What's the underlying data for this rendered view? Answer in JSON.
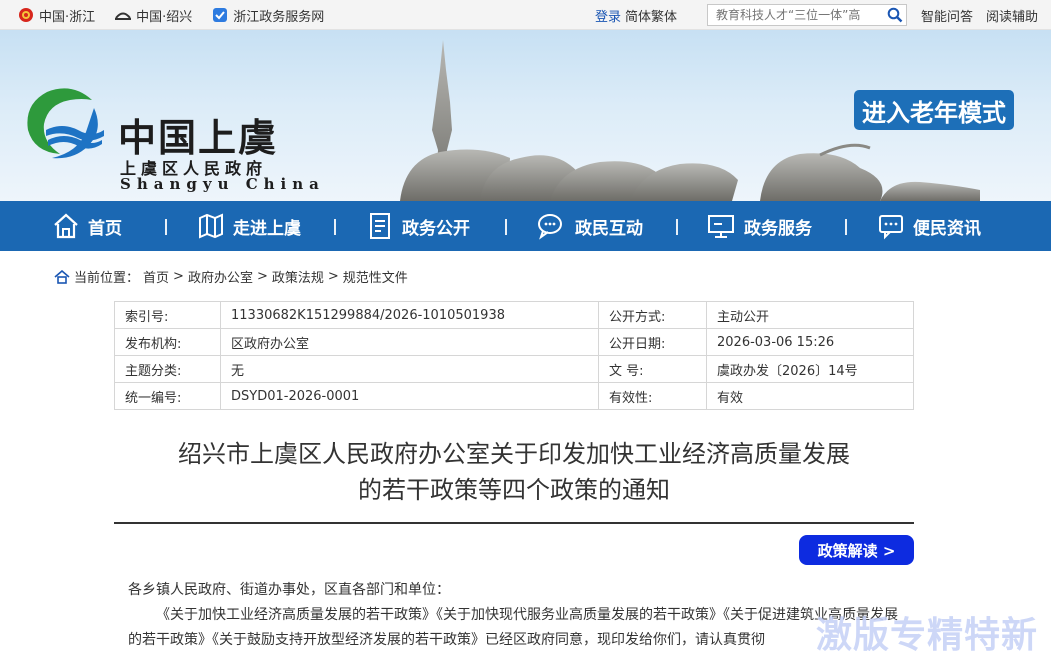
{
  "topbar": {
    "links": [
      {
        "label": "中国·浙江",
        "icon": "national-emblem-icon"
      },
      {
        "label": "中国·绍兴",
        "icon": "bridge-icon"
      },
      {
        "label": "浙江政务服务网",
        "icon": "gov-service-icon"
      }
    ],
    "login": "登录",
    "lang": "简体繁体",
    "search_placeholder": "教育科技人才“三位一体”高",
    "assistant": "智能问答",
    "accessibility": "阅读辅助"
  },
  "banner": {
    "site_name": "中国上虞",
    "site_sub": "上虞区人民政府",
    "site_en": "Shangyu China",
    "elder_mode": "进入老年模式"
  },
  "nav": [
    {
      "label": "首页",
      "icon": "home-icon"
    },
    {
      "label": "走进上虞",
      "icon": "map-icon"
    },
    {
      "label": "政务公开",
      "icon": "document-icon"
    },
    {
      "label": "政民互动",
      "icon": "chat-icon"
    },
    {
      "label": "政务服务",
      "icon": "monitor-icon"
    },
    {
      "label": "便民资讯",
      "icon": "message-icon"
    }
  ],
  "breadcrumb": {
    "prefix": "当前位置：",
    "items": [
      "首页",
      "政府办公室",
      "政策法规",
      "规范性文件"
    ]
  },
  "info": {
    "rows": [
      {
        "k1": "索引号:",
        "v1": "11330682K151299884/2026-1010501938",
        "k2": "公开方式:",
        "v2": "主动公开"
      },
      {
        "k1": "发布机构:",
        "v1": "区政府办公室",
        "k2": "公开日期:",
        "v2": "2026-03-06 15:26"
      },
      {
        "k1": "主题分类:",
        "v1": "无",
        "k2": "文  号:",
        "v2": "虞政办发〔2026〕14号"
      },
      {
        "k1": "统一编号:",
        "v1": "DSYD01-2026-0001",
        "k2": "有效性:",
        "v2": "有效"
      }
    ]
  },
  "doc": {
    "title_line1": "绍兴市上虞区人民政府办公室关于印发加快工业经济高质量发展",
    "title_line2": "的若干政策等四个政策的通知",
    "interpret_btn": "政策解读 >",
    "salutation": "各乡镇人民政府、街道办事处，区直各部门和单位：",
    "para1": "《关于加快工业经济高质量发展的若干政策》《关于加快现代服务业高质量发展的若干政策》《关于促进建筑业高质量发展的若干政策》《关于鼓励支持开放型经济发展的若干政策》已经区政府同意，现印发给你们，请认真贯彻"
  },
  "watermark": "激版专精特新",
  "colors": {
    "nav_bg": "#1b68b3",
    "elder_btn": "#1d6fb8",
    "interpret_btn": "#0d2be0",
    "link": "#1a56b3"
  }
}
